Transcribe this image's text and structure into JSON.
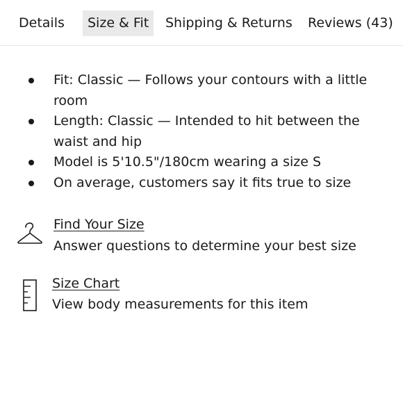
{
  "tabs": [
    {
      "label": "Details",
      "active": false
    },
    {
      "label": "Size & Fit",
      "active": true
    },
    {
      "label": "Shipping & Returns",
      "active": false
    },
    {
      "label": "Reviews (43)",
      "active": false
    }
  ],
  "fit_notes": [
    "Fit: Classic — Follows your contours with a little room",
    "Length: Classic — Intended to hit between the waist and hip",
    "Model is 5'10.5\"/180cm wearing a size S",
    "On average, customers say it fits true to size"
  ],
  "find_your_size": {
    "icon": "hanger-icon",
    "link": "Find Your Size",
    "description": "Answer questions to determine your best size"
  },
  "size_chart": {
    "icon": "ruler-icon",
    "link": "Size Chart",
    "description": "View body measurements for this item"
  },
  "colors": {
    "text": "#1a1a1a",
    "active_tab_bg": "#e9e9e9",
    "divider": "#e6e6e6"
  }
}
